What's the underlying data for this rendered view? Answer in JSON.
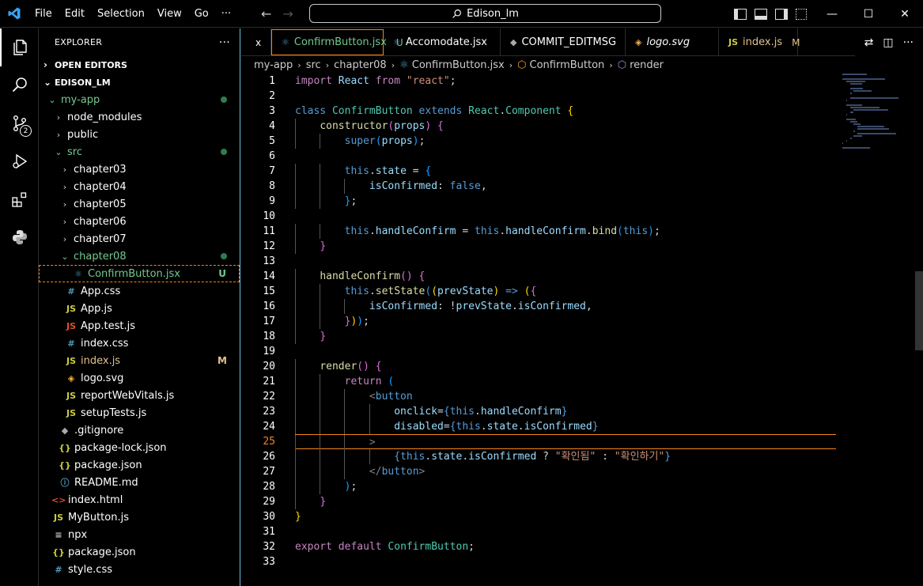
{
  "menu": [
    "File",
    "Edit",
    "Selection",
    "View",
    "Go",
    "···"
  ],
  "command_center": "Edison_lm",
  "sidebar": {
    "title": "EXPLORER",
    "more": "···",
    "open_editors": "OPEN EDITORS",
    "root": "EDISON_LM",
    "items": [
      {
        "label": "my-app",
        "depth": 1,
        "kind": "folder-open",
        "icon": "",
        "status": "dot",
        "color": "green"
      },
      {
        "label": "node_modules",
        "depth": 2,
        "kind": "folder",
        "icon": "",
        "status": "",
        "color": ""
      },
      {
        "label": "public",
        "depth": 2,
        "kind": "folder",
        "icon": "",
        "status": "",
        "color": ""
      },
      {
        "label": "src",
        "depth": 2,
        "kind": "folder-open",
        "icon": "",
        "status": "dot",
        "color": "green"
      },
      {
        "label": "chapter03",
        "depth": 3,
        "kind": "folder",
        "icon": "",
        "status": "",
        "color": ""
      },
      {
        "label": "chapter04",
        "depth": 3,
        "kind": "folder",
        "icon": "",
        "status": "",
        "color": ""
      },
      {
        "label": "chapter05",
        "depth": 3,
        "kind": "folder",
        "icon": "",
        "status": "",
        "color": ""
      },
      {
        "label": "chapter06",
        "depth": 3,
        "kind": "folder",
        "icon": "",
        "status": "",
        "color": ""
      },
      {
        "label": "chapter07",
        "depth": 3,
        "kind": "folder",
        "icon": "",
        "status": "",
        "color": ""
      },
      {
        "label": "chapter08",
        "depth": 3,
        "kind": "folder-open",
        "icon": "",
        "status": "dot",
        "color": "green"
      },
      {
        "label": "ConfirmButton.jsx",
        "depth": 4,
        "kind": "file",
        "icon": "react",
        "status": "U",
        "color": "green",
        "selected": true
      },
      {
        "label": "App.css",
        "depth": 3,
        "kind": "file",
        "icon": "css",
        "status": "",
        "color": ""
      },
      {
        "label": "App.js",
        "depth": 3,
        "kind": "file",
        "icon": "js",
        "status": "",
        "color": ""
      },
      {
        "label": "App.test.js",
        "depth": 3,
        "kind": "file",
        "icon": "jstest",
        "status": "",
        "color": ""
      },
      {
        "label": "index.css",
        "depth": 3,
        "kind": "file",
        "icon": "css",
        "status": "",
        "color": ""
      },
      {
        "label": "index.js",
        "depth": 3,
        "kind": "file",
        "icon": "js",
        "status": "M",
        "color": "yellow"
      },
      {
        "label": "logo.svg",
        "depth": 3,
        "kind": "file",
        "icon": "svg",
        "status": "",
        "color": ""
      },
      {
        "label": "reportWebVitals.js",
        "depth": 3,
        "kind": "file",
        "icon": "js",
        "status": "",
        "color": ""
      },
      {
        "label": "setupTests.js",
        "depth": 3,
        "kind": "file",
        "icon": "js",
        "status": "",
        "color": ""
      },
      {
        "label": ".gitignore",
        "depth": 2,
        "kind": "file",
        "icon": "git",
        "status": "",
        "color": ""
      },
      {
        "label": "package-lock.json",
        "depth": 2,
        "kind": "file",
        "icon": "json",
        "status": "",
        "color": ""
      },
      {
        "label": "package.json",
        "depth": 2,
        "kind": "file",
        "icon": "json",
        "status": "",
        "color": ""
      },
      {
        "label": "README.md",
        "depth": 2,
        "kind": "file",
        "icon": "info",
        "status": "",
        "color": ""
      },
      {
        "label": "index.html",
        "depth": 1,
        "kind": "file",
        "icon": "html",
        "status": "",
        "color": ""
      },
      {
        "label": "MyButton.js",
        "depth": 1,
        "kind": "file",
        "icon": "js",
        "status": "",
        "color": ""
      },
      {
        "label": "npx",
        "depth": 1,
        "kind": "file",
        "icon": "npx",
        "status": "",
        "color": ""
      },
      {
        "label": "package.json",
        "depth": 1,
        "kind": "file",
        "icon": "json",
        "status": "",
        "color": ""
      },
      {
        "label": "style.css",
        "depth": 1,
        "kind": "file",
        "icon": "css",
        "status": "",
        "color": ""
      }
    ]
  },
  "tabs": [
    {
      "label": "",
      "icon": "",
      "mark": "x",
      "active": false,
      "color": ""
    },
    {
      "label": "ConfirmButton.jsx",
      "icon": "react",
      "mark": "U",
      "active": true,
      "color": "green"
    },
    {
      "label": "Accomodate.jsx",
      "icon": "react",
      "mark": "",
      "active": false,
      "color": ""
    },
    {
      "label": "COMMIT_EDITMSG",
      "icon": "git",
      "mark": "",
      "active": false,
      "color": ""
    },
    {
      "label": "logo.svg",
      "icon": "svg",
      "mark": "",
      "active": false,
      "color": "",
      "italic": true
    },
    {
      "label": "index.js",
      "icon": "js",
      "mark": "M",
      "active": false,
      "color": "yellow"
    }
  ],
  "breadcrumb": [
    "my-app",
    "src",
    "chapter08",
    "ConfirmButton.jsx",
    "ConfirmButton",
    "render"
  ],
  "editor": {
    "current_line": 25,
    "lines": [
      [
        [
          "kw2",
          "import"
        ],
        [
          "pun",
          " "
        ],
        [
          "var",
          "React"
        ],
        [
          "pun",
          " "
        ],
        [
          "kw2",
          "from"
        ],
        [
          "pun",
          " "
        ],
        [
          "str",
          "\"react\""
        ],
        [
          "pun",
          ";"
        ]
      ],
      [],
      [
        [
          "kw",
          "class"
        ],
        [
          "pun",
          " "
        ],
        [
          "cls",
          "ConfirmButton"
        ],
        [
          "pun",
          " "
        ],
        [
          "kw",
          "extends"
        ],
        [
          "pun",
          " "
        ],
        [
          "cls",
          "React"
        ],
        [
          "pun",
          "."
        ],
        [
          "cls",
          "Component"
        ],
        [
          "pun",
          " "
        ],
        [
          "br1",
          "{"
        ]
      ],
      [
        [
          "pun",
          "    "
        ],
        [
          "fn",
          "constructor"
        ],
        [
          "br2",
          "("
        ],
        [
          "var",
          "props"
        ],
        [
          "br2",
          ")"
        ],
        [
          "pun",
          " "
        ],
        [
          "br2",
          "{"
        ]
      ],
      [
        [
          "pun",
          "        "
        ],
        [
          "kw",
          "super"
        ],
        [
          "br3",
          "("
        ],
        [
          "var",
          "props"
        ],
        [
          "br3",
          ")"
        ],
        [
          "pun",
          ";"
        ]
      ],
      [],
      [
        [
          "pun",
          "        "
        ],
        [
          "kw",
          "this"
        ],
        [
          "pun",
          "."
        ],
        [
          "var",
          "state"
        ],
        [
          "pun",
          " = "
        ],
        [
          "br3",
          "{"
        ]
      ],
      [
        [
          "pun",
          "            "
        ],
        [
          "var",
          "isConfirmed"
        ],
        [
          "pun",
          ": "
        ],
        [
          "kw",
          "false"
        ],
        [
          "pun",
          ","
        ]
      ],
      [
        [
          "pun",
          "        "
        ],
        [
          "br3",
          "}"
        ],
        [
          "pun",
          ";"
        ]
      ],
      [],
      [
        [
          "pun",
          "        "
        ],
        [
          "kw",
          "this"
        ],
        [
          "pun",
          "."
        ],
        [
          "var",
          "handleConfirm"
        ],
        [
          "pun",
          " = "
        ],
        [
          "kw",
          "this"
        ],
        [
          "pun",
          "."
        ],
        [
          "var",
          "handleConfirm"
        ],
        [
          "pun",
          "."
        ],
        [
          "fn",
          "bind"
        ],
        [
          "br3",
          "("
        ],
        [
          "kw",
          "this"
        ],
        [
          "br3",
          ")"
        ],
        [
          "pun",
          ";"
        ]
      ],
      [
        [
          "pun",
          "    "
        ],
        [
          "br2",
          "}"
        ]
      ],
      [],
      [
        [
          "pun",
          "    "
        ],
        [
          "fn",
          "handleConfirm"
        ],
        [
          "br2",
          "()"
        ],
        [
          "pun",
          " "
        ],
        [
          "br2",
          "{"
        ]
      ],
      [
        [
          "pun",
          "        "
        ],
        [
          "kw",
          "this"
        ],
        [
          "pun",
          "."
        ],
        [
          "fn",
          "setState"
        ],
        [
          "br3",
          "("
        ],
        [
          "br1",
          "("
        ],
        [
          "var",
          "prevState"
        ],
        [
          "br1",
          ")"
        ],
        [
          "pun",
          " "
        ],
        [
          "kw",
          "=>"
        ],
        [
          "pun",
          " "
        ],
        [
          "br1",
          "("
        ],
        [
          "br2",
          "{"
        ]
      ],
      [
        [
          "pun",
          "            "
        ],
        [
          "var",
          "isConfirmed"
        ],
        [
          "pun",
          ": !"
        ],
        [
          "var",
          "prevState"
        ],
        [
          "pun",
          "."
        ],
        [
          "var",
          "isConfirmed"
        ],
        [
          "pun",
          ","
        ]
      ],
      [
        [
          "pun",
          "        "
        ],
        [
          "br2",
          "}"
        ],
        [
          "br1",
          ")"
        ],
        [
          "br3",
          ")"
        ],
        [
          "pun",
          ";"
        ]
      ],
      [
        [
          "pun",
          "    "
        ],
        [
          "br2",
          "}"
        ]
      ],
      [],
      [
        [
          "pun",
          "    "
        ],
        [
          "fn",
          "render"
        ],
        [
          "br2",
          "()"
        ],
        [
          "pun",
          " "
        ],
        [
          "br2",
          "{"
        ]
      ],
      [
        [
          "pun",
          "        "
        ],
        [
          "kw2",
          "return"
        ],
        [
          "pun",
          " "
        ],
        [
          "br3",
          "("
        ]
      ],
      [
        [
          "pun",
          "            "
        ],
        [
          "tagb",
          "<"
        ],
        [
          "tag",
          "button"
        ]
      ],
      [
        [
          "pun",
          "                "
        ],
        [
          "var",
          "onclick"
        ],
        [
          "pun",
          "="
        ],
        [
          "kw",
          "{"
        ],
        [
          "kw",
          "this"
        ],
        [
          "pun",
          "."
        ],
        [
          "var",
          "handleConfirm"
        ],
        [
          "kw",
          "}"
        ]
      ],
      [
        [
          "pun",
          "                "
        ],
        [
          "var",
          "disabled"
        ],
        [
          "pun",
          "="
        ],
        [
          "kw",
          "{"
        ],
        [
          "kw",
          "this"
        ],
        [
          "pun",
          "."
        ],
        [
          "var",
          "state"
        ],
        [
          "pun",
          "."
        ],
        [
          "var",
          "isConfirmed"
        ],
        [
          "kw",
          "}"
        ]
      ],
      [
        [
          "pun",
          "            "
        ],
        [
          "tagb",
          ">"
        ]
      ],
      [
        [
          "pun",
          "                "
        ],
        [
          "kw",
          "{"
        ],
        [
          "kw",
          "this"
        ],
        [
          "pun",
          "."
        ],
        [
          "var",
          "state"
        ],
        [
          "pun",
          "."
        ],
        [
          "var",
          "isConfirmed"
        ],
        [
          "pun",
          " ? "
        ],
        [
          "str",
          "\"확인됨\""
        ],
        [
          "pun",
          " : "
        ],
        [
          "str",
          "\"확인하기\""
        ],
        [
          "kw",
          "}"
        ]
      ],
      [
        [
          "pun",
          "            "
        ],
        [
          "tagb",
          "</"
        ],
        [
          "tag",
          "button"
        ],
        [
          "tagb",
          ">"
        ]
      ],
      [
        [
          "pun",
          "        "
        ],
        [
          "br3",
          ")"
        ],
        [
          "pun",
          ";"
        ]
      ],
      [
        [
          "pun",
          "    "
        ],
        [
          "br2",
          "}"
        ]
      ],
      [
        [
          "br1",
          "}"
        ]
      ],
      [],
      [
        [
          "kw2",
          "export"
        ],
        [
          "pun",
          " "
        ],
        [
          "kw2",
          "default"
        ],
        [
          "pun",
          " "
        ],
        [
          "cls",
          "ConfirmButton"
        ],
        [
          "pun",
          ";"
        ]
      ],
      []
    ]
  }
}
